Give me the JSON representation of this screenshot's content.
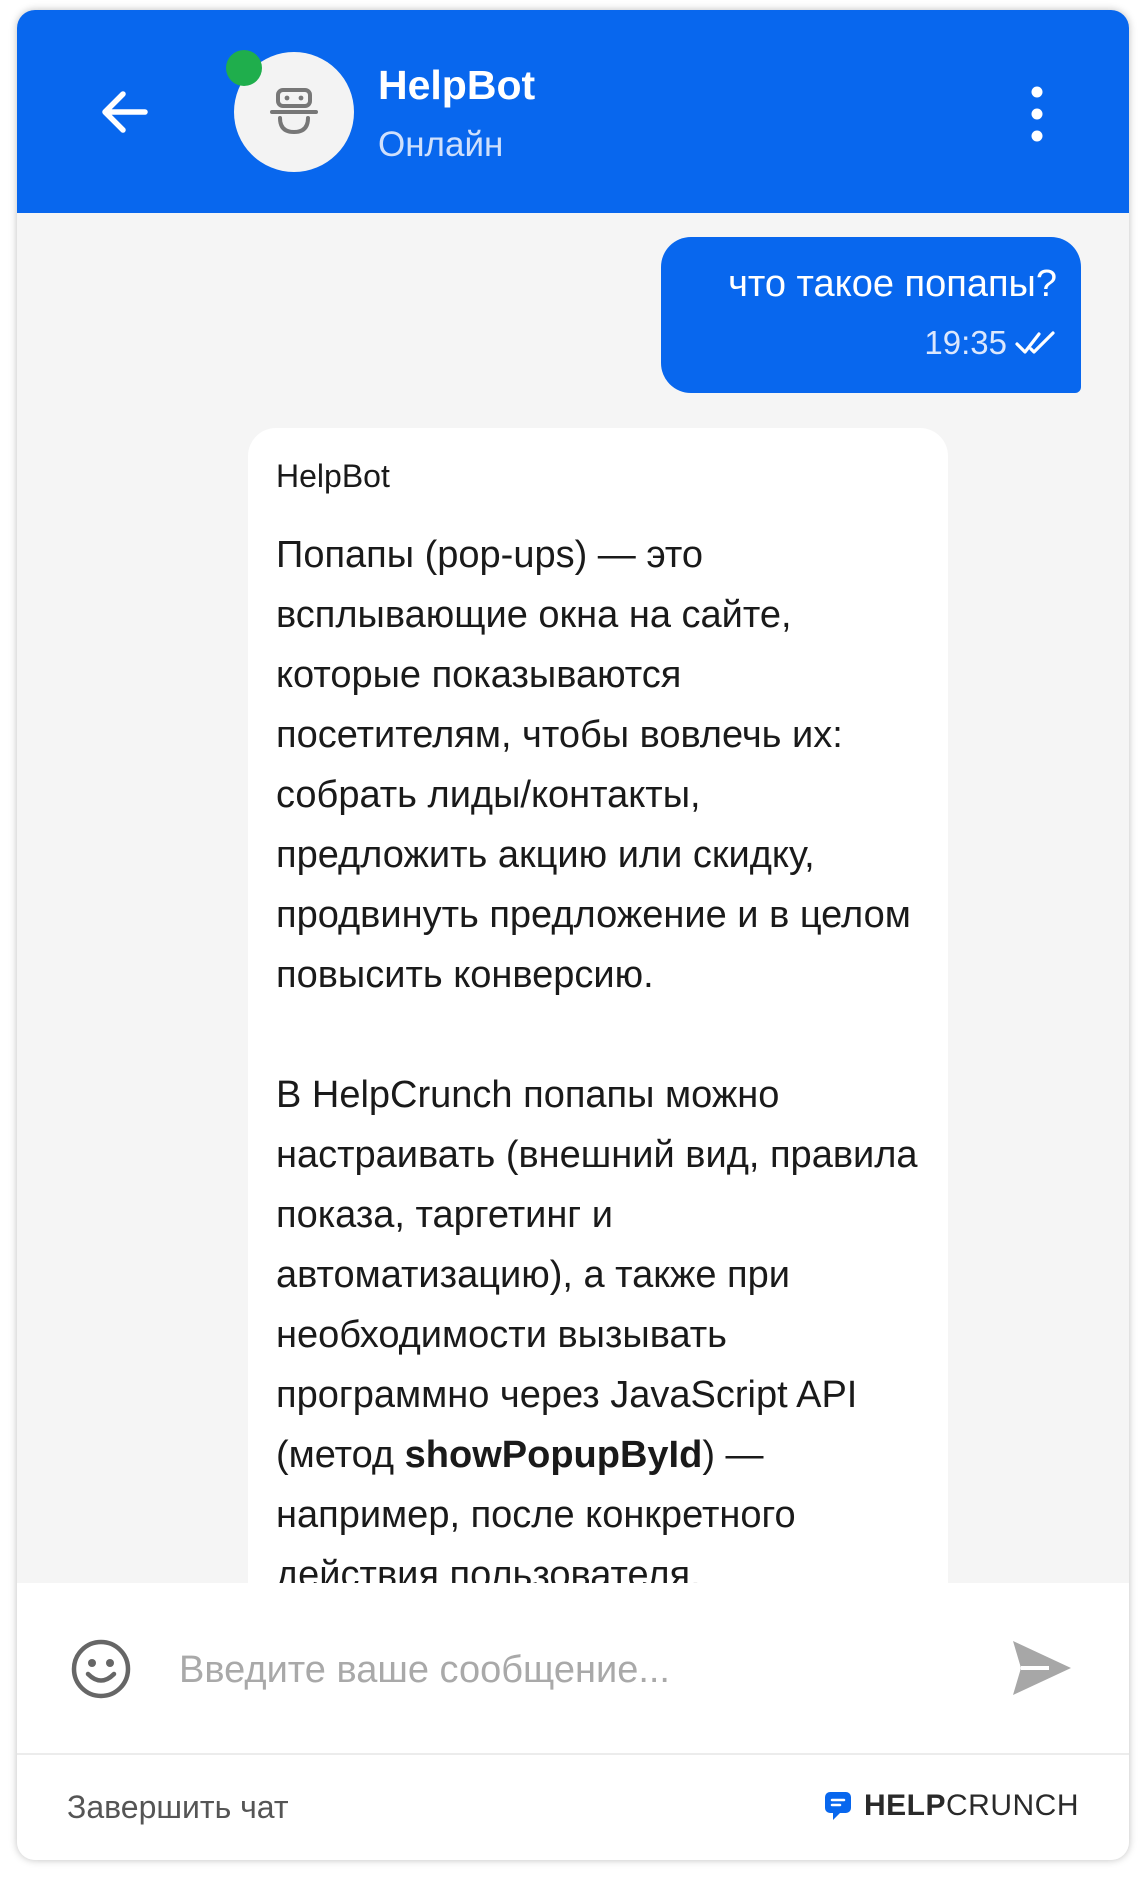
{
  "header": {
    "bot_name": "HelpBot",
    "status": "Онлайн",
    "accent_color": "#0867ee",
    "online_color": "#1fae4c"
  },
  "messages": {
    "user": {
      "text": "что такое попапы?",
      "time": "19:35",
      "read_icon": "double-check-icon"
    },
    "bot": {
      "sender": "HelpBot",
      "paragraph_1": "Попапы (pop-ups) — это всплывающие окна на сайте, которые показываются посетителям, чтобы вовлечь их: собрать лиды/контакты, предложить акцию или скидку, продвинуть предложение и в целом повысить конверсию.",
      "paragraph_2_part_1": "В HelpCrunch попапы можно настраивать (внешний вид, правила показа, таргетинг и автоматизацию), а также при необходимости вызывать программно через JavaScript API (метод ",
      "paragraph_2_bold": "showPopupById",
      "paragraph_2_part_2": ") — например, после конкретного действия пользователя."
    }
  },
  "composer": {
    "placeholder": "Введите ваше сообщение...",
    "emoji_icon": "smiley-icon",
    "send_icon": "send-icon"
  },
  "footer": {
    "end_chat_label": "Завершить чат",
    "brand_bold": "HELP",
    "brand_light": "CRUNCH"
  }
}
